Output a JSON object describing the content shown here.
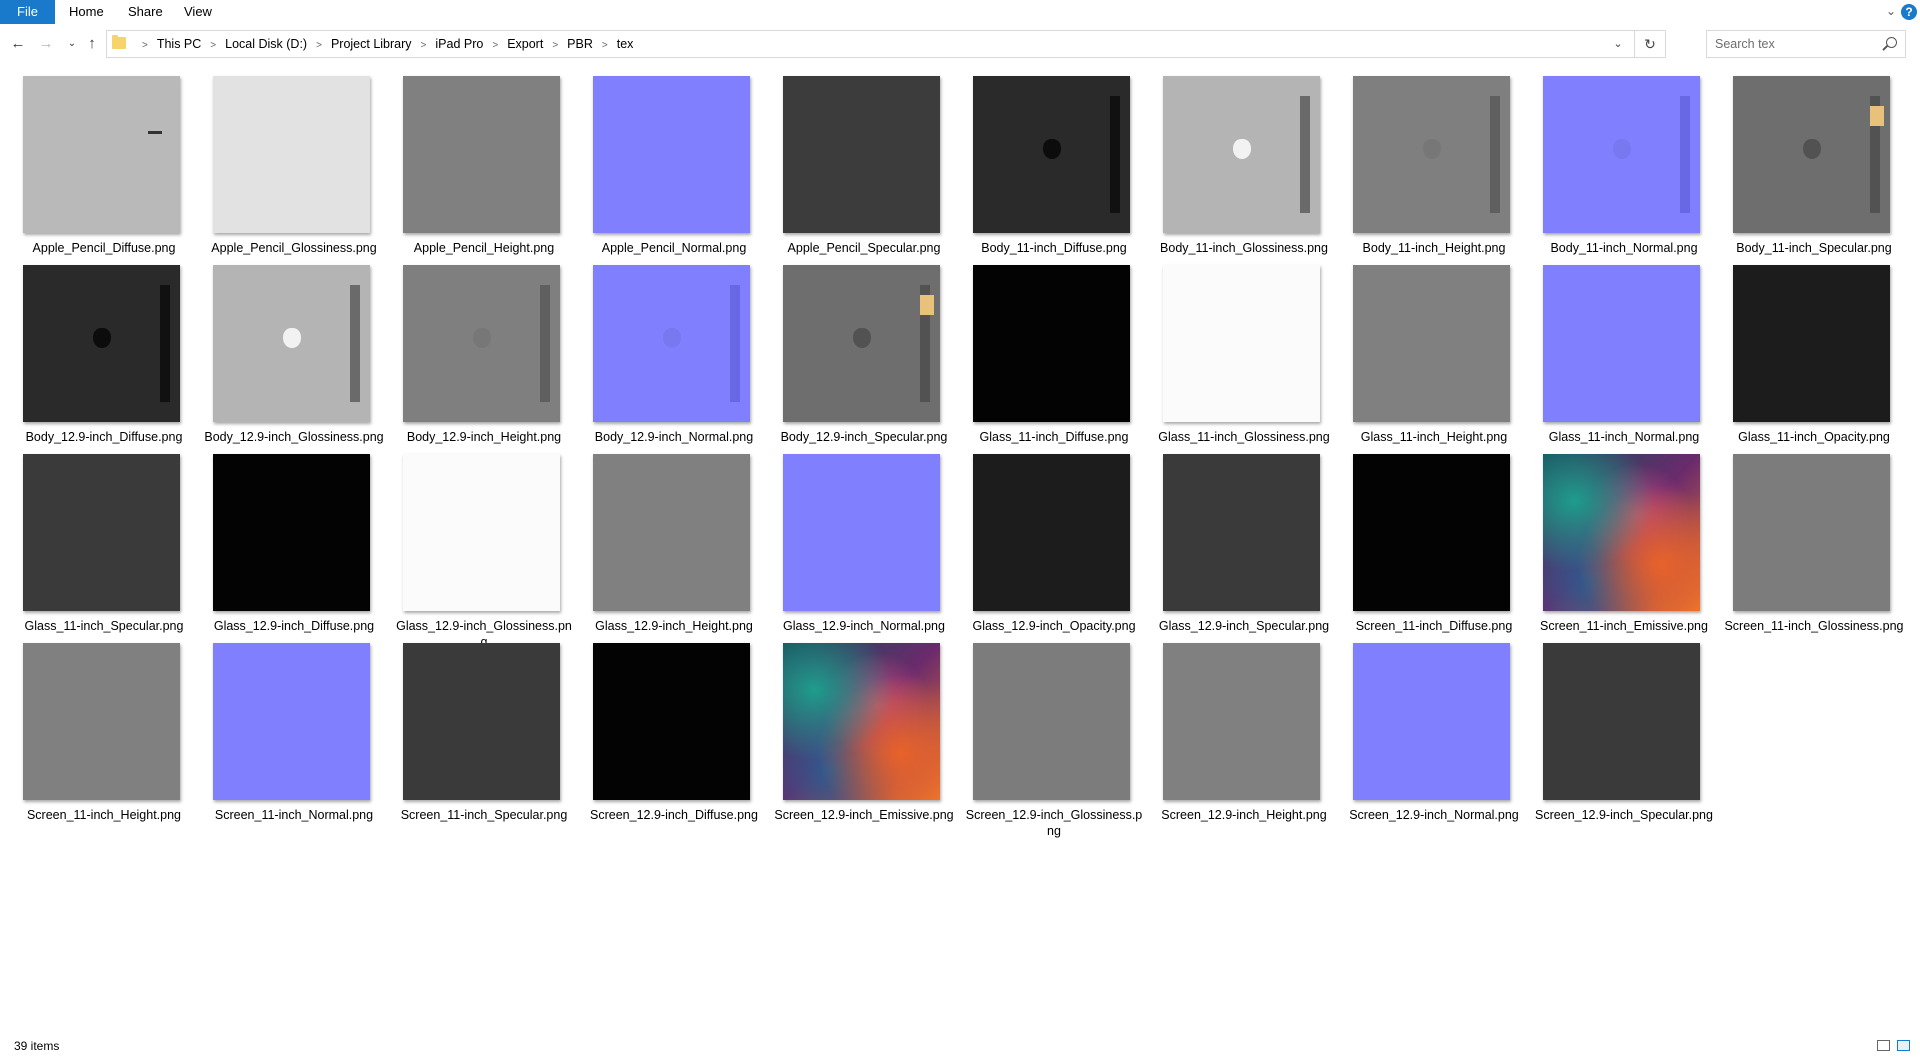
{
  "ribbon": {
    "file": "File",
    "home": "Home",
    "share": "Share",
    "view": "View",
    "help": "?"
  },
  "nav": {
    "back": "←",
    "forward": "→",
    "recent": "⌄",
    "up": "↑"
  },
  "breadcrumb": [
    "This PC",
    "Local Disk (D:)",
    "Project Library",
    "iPad Pro",
    "Export",
    "PBR",
    "tex"
  ],
  "search": {
    "placeholder": "Search tex"
  },
  "files": [
    {
      "name": "Apple_Pencil_Diffuse.png",
      "color": "#b9b9b9"
    },
    {
      "name": "Apple_Pencil_Glossiness.png",
      "color": "#e2e2e2"
    },
    {
      "name": "Apple_Pencil_Height.png",
      "color": "#808080"
    },
    {
      "name": "Apple_Pencil_Normal.png",
      "color": "#8080ff"
    },
    {
      "name": "Apple_Pencil_Specular.png",
      "color": "#3c3c3c"
    },
    {
      "name": "Body_11-inch_Diffuse.png",
      "color": "#2a2a2a"
    },
    {
      "name": "Body_11-inch_Glossiness.png",
      "color": "#b4b4b4"
    },
    {
      "name": "Body_11-inch_Height.png",
      "color": "#7f7f7f"
    },
    {
      "name": "Body_11-inch_Normal.png",
      "color": "#8080ff"
    },
    {
      "name": "Body_11-inch_Specular.png",
      "color": "#6e6e6e"
    },
    {
      "name": "Body_12.9-inch_Diffuse.png",
      "color": "#2a2a2a"
    },
    {
      "name": "Body_12.9-inch_Glossiness.png",
      "color": "#b4b4b4"
    },
    {
      "name": "Body_12.9-inch_Height.png",
      "color": "#7f7f7f"
    },
    {
      "name": "Body_12.9-inch_Normal.png",
      "color": "#8080ff"
    },
    {
      "name": "Body_12.9-inch_Specular.png",
      "color": "#6e6e6e"
    },
    {
      "name": "Glass_11-inch_Diffuse.png",
      "color": "#030303"
    },
    {
      "name": "Glass_11-inch_Glossiness.png",
      "color": "#fbfbfb"
    },
    {
      "name": "Glass_11-inch_Height.png",
      "color": "#808080"
    },
    {
      "name": "Glass_11-inch_Normal.png",
      "color": "#8080ff"
    },
    {
      "name": "Glass_11-inch_Opacity.png",
      "color": "#1c1c1c"
    },
    {
      "name": "Glass_11-inch_Specular.png",
      "color": "#3a3a3a"
    },
    {
      "name": "Glass_12.9-inch_Diffuse.png",
      "color": "#030303"
    },
    {
      "name": "Glass_12.9-inch_Glossiness.png",
      "color": "#fbfbfb"
    },
    {
      "name": "Glass_12.9-inch_Height.png",
      "color": "#808080"
    },
    {
      "name": "Glass_12.9-inch_Normal.png",
      "color": "#8080ff"
    },
    {
      "name": "Glass_12.9-inch_Opacity.png",
      "color": "#1c1c1c"
    },
    {
      "name": "Glass_12.9-inch_Specular.png",
      "color": "#3a3a3a"
    },
    {
      "name": "Screen_11-inch_Diffuse.png",
      "color": "#030303"
    },
    {
      "name": "Screen_11-inch_Emissive.png",
      "color": "swirl"
    },
    {
      "name": "Screen_11-inch_Glossiness.png",
      "color": "#7c7c7c"
    },
    {
      "name": "Screen_11-inch_Height.png",
      "color": "#808080"
    },
    {
      "name": "Screen_11-inch_Normal.png",
      "color": "#8080ff"
    },
    {
      "name": "Screen_11-inch_Specular.png",
      "color": "#3a3a3a"
    },
    {
      "name": "Screen_12.9-inch_Diffuse.png",
      "color": "#030303"
    },
    {
      "name": "Screen_12.9-inch_Emissive.png",
      "color": "swirl"
    },
    {
      "name": "Screen_12.9-inch_Glossiness.png",
      "color": "#7c7c7c"
    },
    {
      "name": "Screen_12.9-inch_Height.png",
      "color": "#808080"
    },
    {
      "name": "Screen_12.9-inch_Normal.png",
      "color": "#8080ff"
    },
    {
      "name": "Screen_12.9-inch_Specular.png",
      "color": "#3a3a3a"
    }
  ],
  "status": {
    "count": "39 items"
  }
}
